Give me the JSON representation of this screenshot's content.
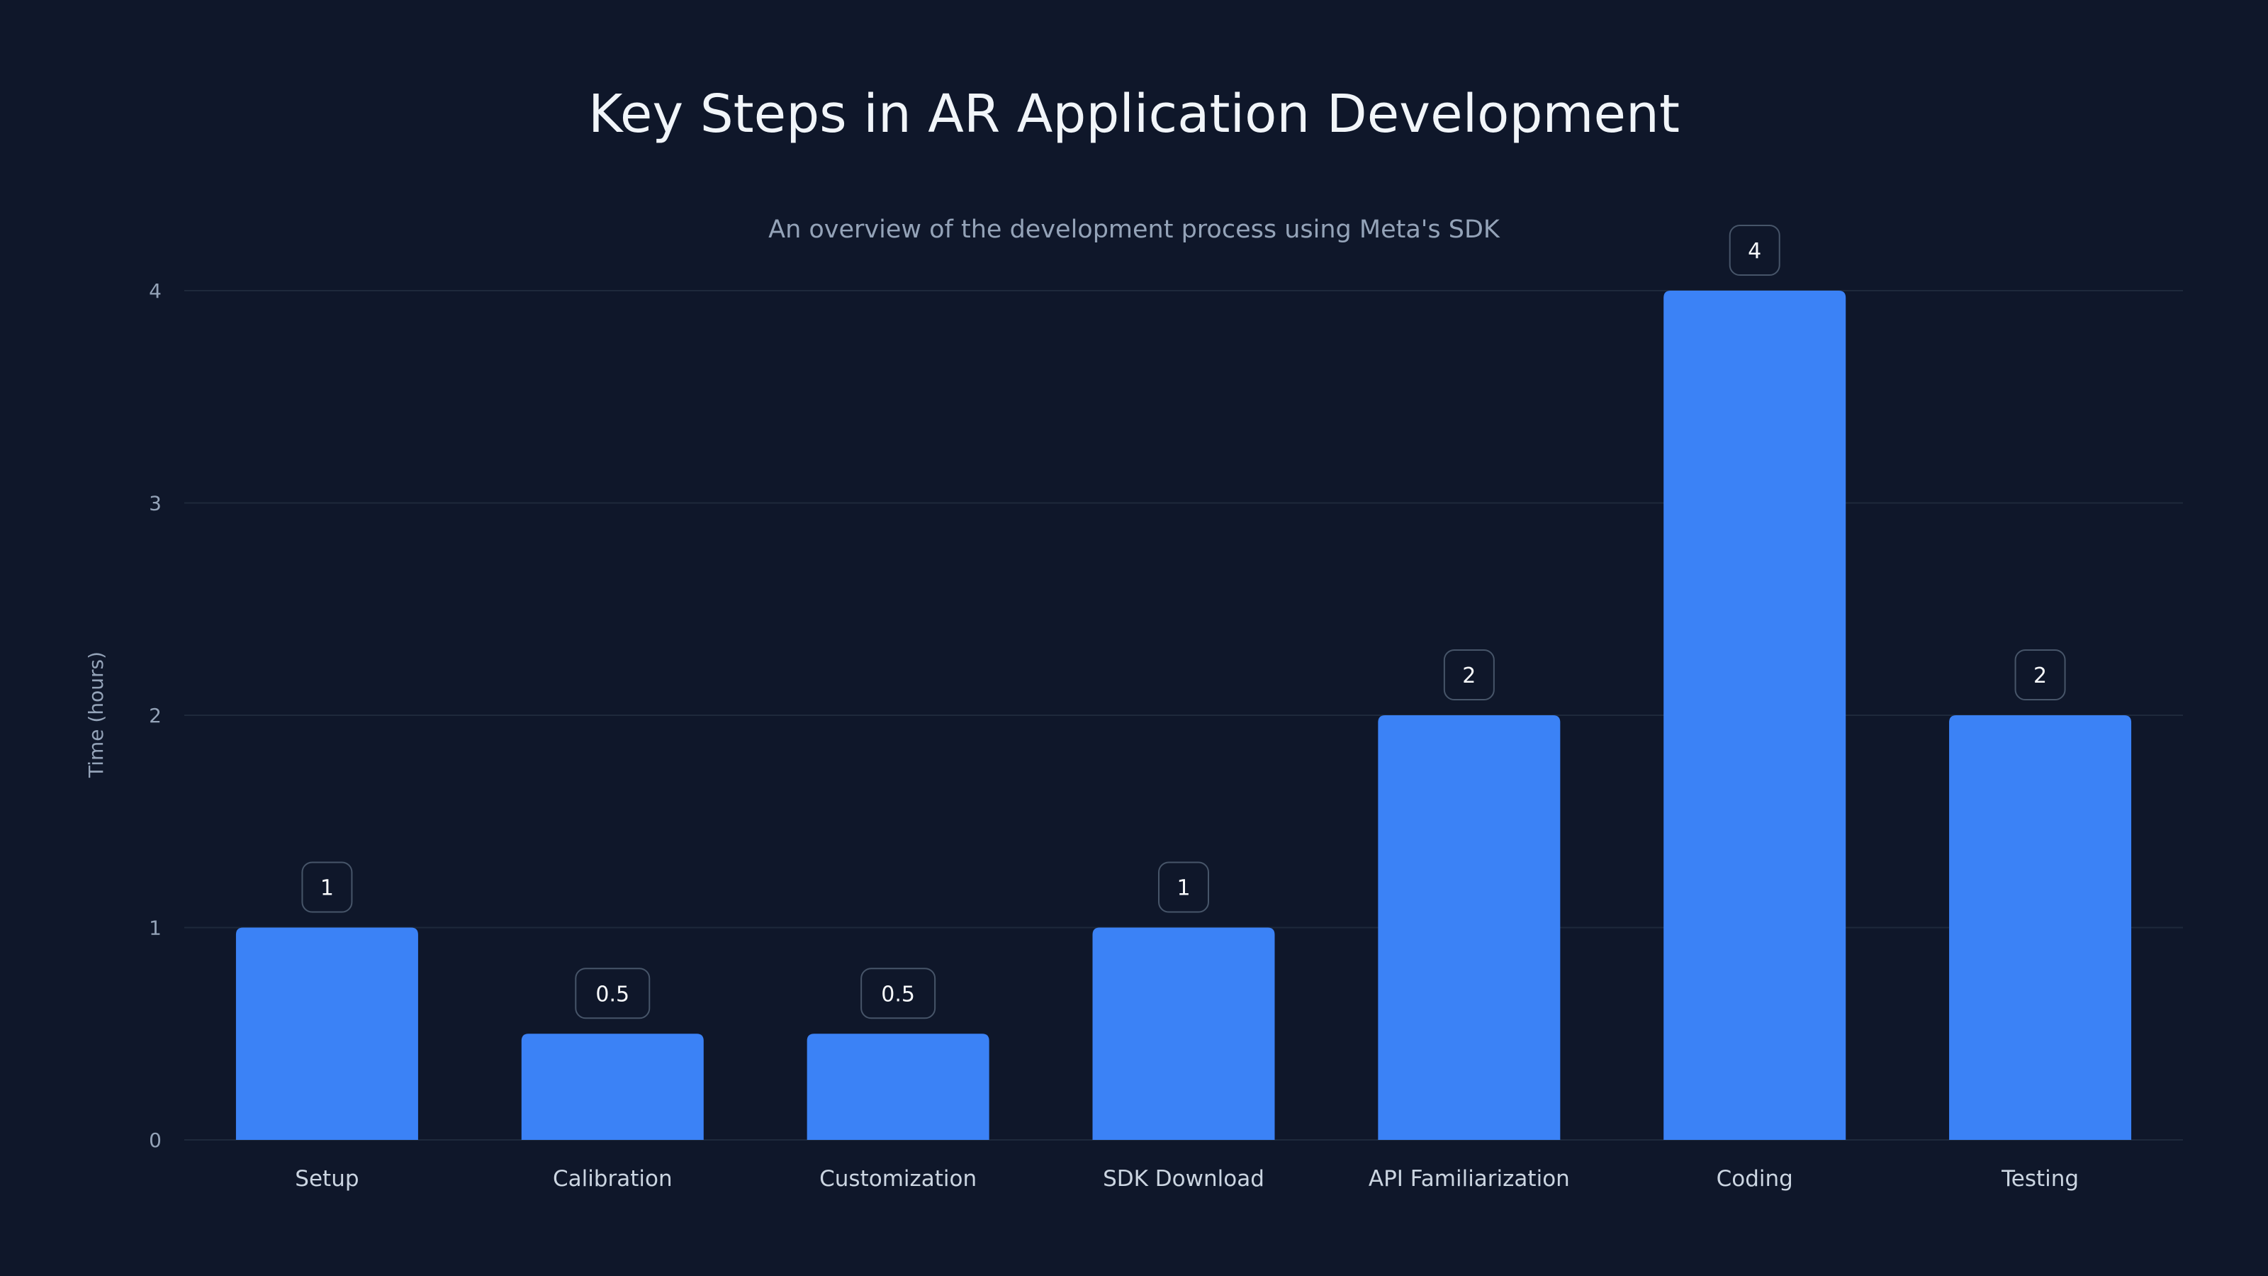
{
  "chart_data": {
    "type": "bar",
    "title": "Key Steps in AR Application Development",
    "subtitle": "An overview of the development process using Meta's SDK",
    "xlabel": "",
    "ylabel": "Time (hours)",
    "categories": [
      "Setup",
      "Calibration",
      "Customization",
      "SDK Download",
      "API Familiarization",
      "Coding",
      "Testing"
    ],
    "values": [
      1,
      0.5,
      0.5,
      1,
      2,
      4,
      2
    ],
    "data_labels": [
      "1",
      "0.5",
      "0.5",
      "1",
      "2",
      "4",
      "2"
    ],
    "ylim": [
      0,
      4
    ],
    "yticks": [
      "0",
      "1",
      "2",
      "3",
      "4"
    ],
    "grid": true,
    "legend": "none"
  },
  "colors": {
    "background": "#0f172a",
    "bar": "#3b82f6",
    "grid": "#1e293b",
    "label_box_fill": "#0f172a",
    "label_box_stroke": "#475569"
  }
}
